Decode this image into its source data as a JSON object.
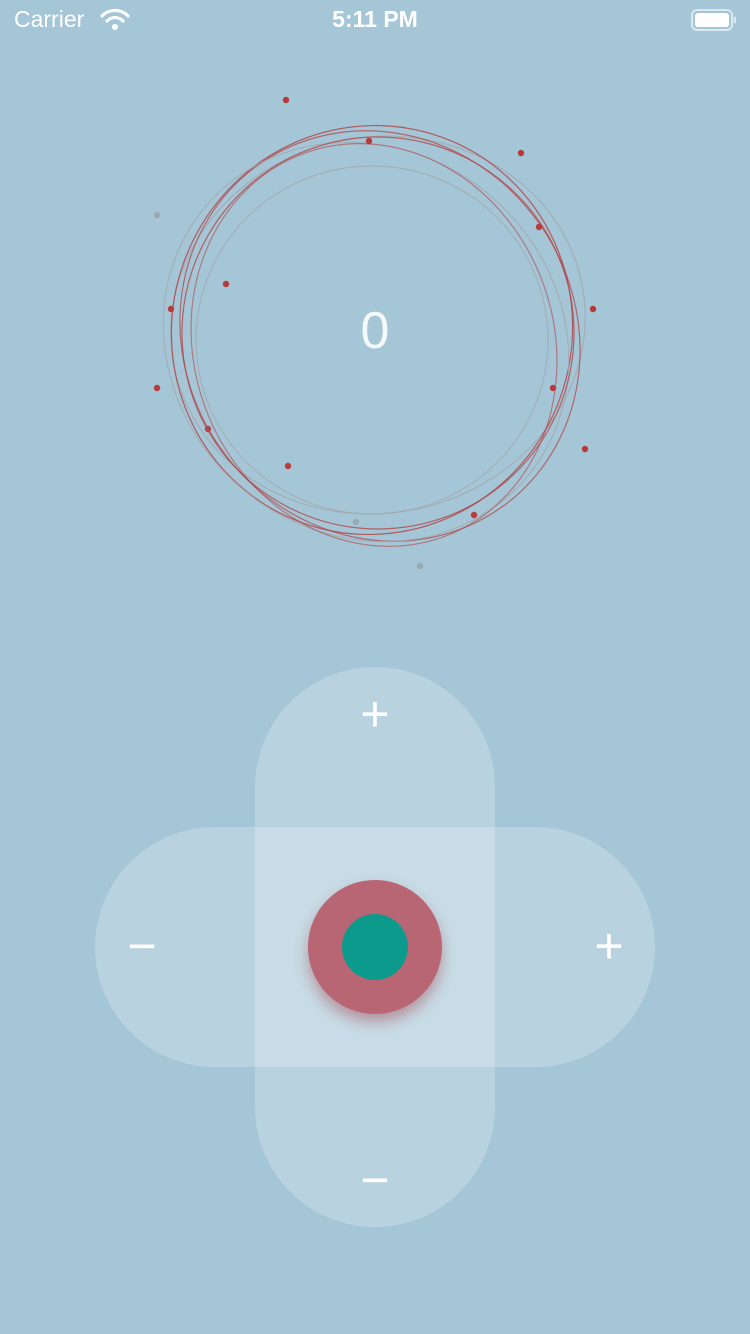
{
  "status_bar": {
    "carrier": "Carrier",
    "time": "5:11 PM",
    "icons": [
      "wifi-icon",
      "battery-icon"
    ]
  },
  "orbit": {
    "counter": "0",
    "colors": {
      "line_red": "#b0474a",
      "line_gray": "#9aa2aa",
      "dot_red": "#b83a3a",
      "dot_gray": "#9aa8b0"
    }
  },
  "controls": {
    "up_label": "+",
    "down_label": "−",
    "left_label": "−",
    "right_label": "+",
    "knob_colors": {
      "outer": "#b86673",
      "inner": "#0c9a8c"
    }
  },
  "theme": {
    "background": "#a5c6d7"
  }
}
